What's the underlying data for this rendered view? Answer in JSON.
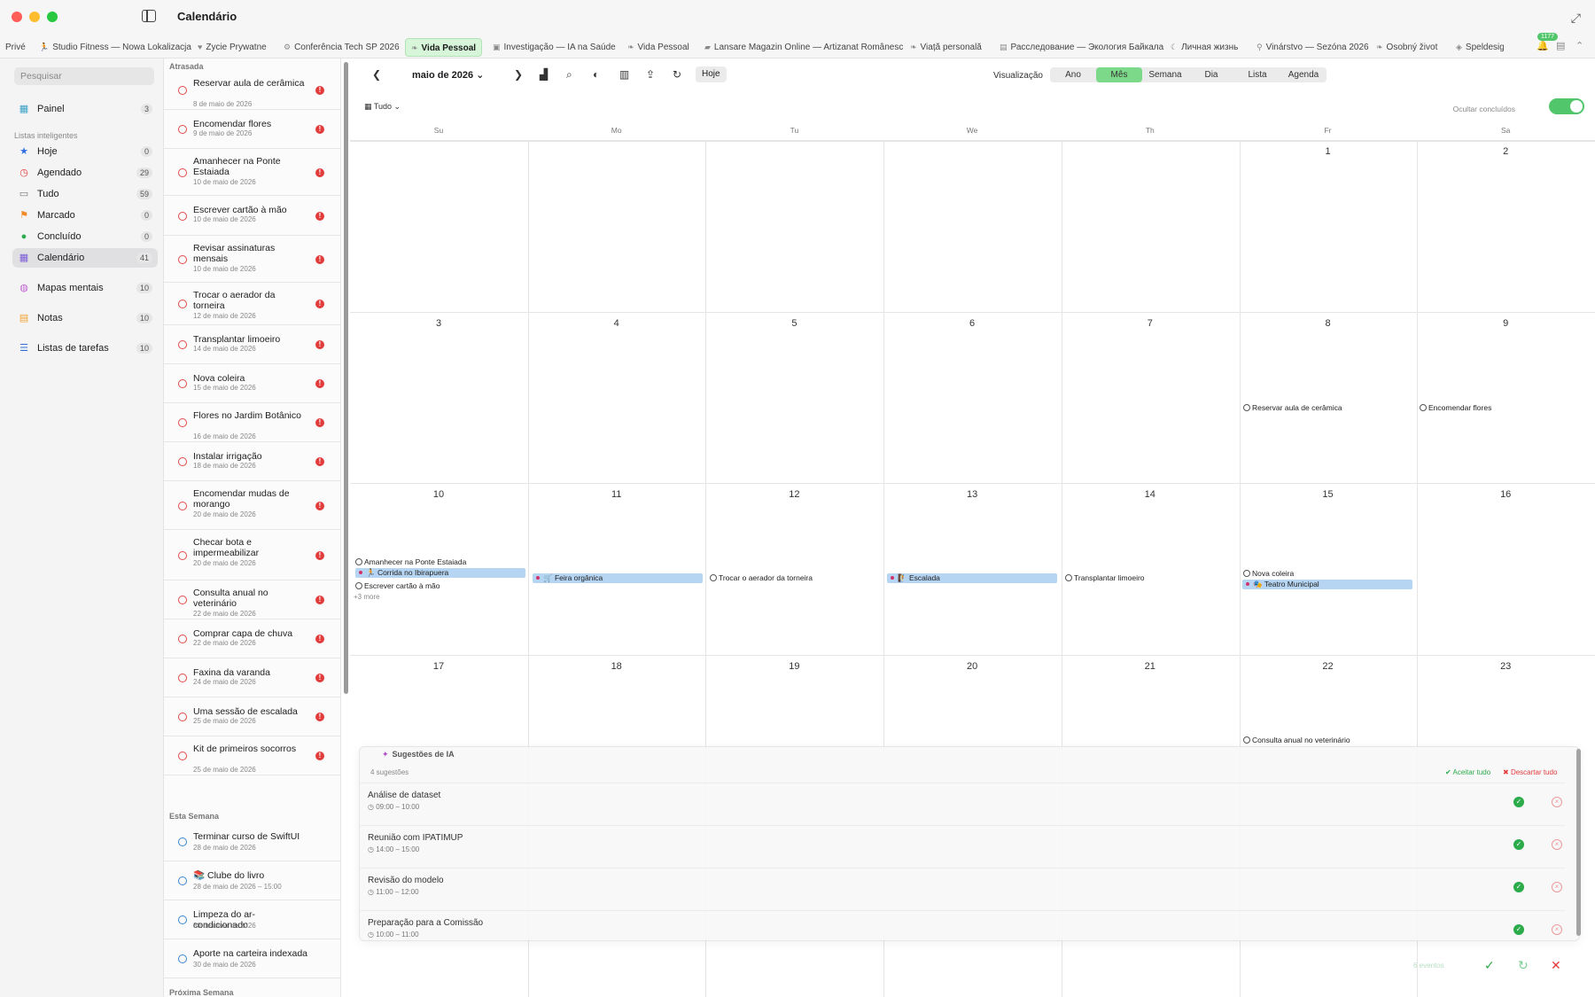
{
  "window": {
    "title": "Calendário"
  },
  "tabs": [
    {
      "label": "Privé",
      "icon": ""
    },
    {
      "label": "Studio Fitness — Nowa Lokalizacja",
      "icon": "run-icon"
    },
    {
      "label": "Zycie Prywatne",
      "icon": "heart-icon"
    },
    {
      "label": "Conferência Tech SP 2026",
      "icon": "gear-icon"
    },
    {
      "label": "Vida Pessoal",
      "icon": "leaf-icon",
      "active": true
    },
    {
      "label": "Investigação — IA na Saúde",
      "icon": "briefcase-icon"
    },
    {
      "label": "Vida Pessoal",
      "icon": "leaf-icon"
    },
    {
      "label": "Lansare Magazin Online — Artizanat Românesc",
      "icon": "bag-icon"
    },
    {
      "label": "Viață personală",
      "icon": "leaf-icon"
    },
    {
      "label": "Расследование — Экология Байкала",
      "icon": "doc-icon"
    },
    {
      "label": "Личная жизнь",
      "icon": "moon-icon"
    },
    {
      "label": "Vinárstvo — Sezóna 2026",
      "icon": "pin-icon"
    },
    {
      "label": "Osobný život",
      "icon": "leaf-icon"
    },
    {
      "label": "Speldesign — A",
      "icon": "game-icon"
    }
  ],
  "tab_badge": "1177",
  "sidebar": {
    "search_placeholder": "Pesquisar",
    "dashboard": {
      "label": "Painel",
      "count": "3"
    },
    "smart_lists_header": "Listas inteligentes",
    "items": [
      {
        "label": "Hoje",
        "count": "0",
        "icon": "star-icon",
        "color": "#2f6fe0"
      },
      {
        "label": "Agendado",
        "count": "29",
        "icon": "clock-icon",
        "color": "#e23b3b"
      },
      {
        "label": "Tudo",
        "count": "59",
        "icon": "tray-icon",
        "color": "#777777"
      },
      {
        "label": "Marcado",
        "count": "0",
        "icon": "flag-icon",
        "color": "#f08a24"
      },
      {
        "label": "Concluído",
        "count": "0",
        "icon": "check-circle-icon",
        "color": "#2bab4a"
      },
      {
        "label": "Calendário",
        "count": "41",
        "icon": "calendar-icon",
        "color": "#7b5cd6"
      }
    ],
    "extra": [
      {
        "label": "Mapas mentais",
        "count": "10",
        "icon": "brain-icon"
      },
      {
        "label": "Notas",
        "count": "10",
        "icon": "note-icon"
      },
      {
        "label": "Listas de tarefas",
        "count": "10",
        "icon": "list-icon"
      }
    ]
  },
  "tasks": {
    "overdue_header": "Atrasada",
    "overdue": [
      {
        "title": "Reservar aula de cerâmica",
        "date": "8 de maio de 2026"
      },
      {
        "title": "Encomendar flores",
        "date": "9 de maio de 2026"
      },
      {
        "title": "Amanhecer na Ponte Estaiada",
        "date": "10 de maio de 2026"
      },
      {
        "title": "Escrever cartão à mão",
        "date": "10 de maio de 2026"
      },
      {
        "title": "Revisar assinaturas mensais",
        "date": "10 de maio de 2026"
      },
      {
        "title": "Trocar o aerador da torneira",
        "date": "12 de maio de 2026"
      },
      {
        "title": "Transplantar limoeiro",
        "date": "14 de maio de 2026"
      },
      {
        "title": "Nova coleira",
        "date": "15 de maio de 2026"
      },
      {
        "title": "Flores no Jardim Botânico",
        "date": "16 de maio de 2026"
      },
      {
        "title": "Instalar irrigação",
        "date": "18 de maio de 2026"
      },
      {
        "title": "Encomendar mudas de morango",
        "date": "20 de maio de 2026"
      },
      {
        "title": "Checar bota e impermeabilizar",
        "date": "20 de maio de 2026"
      },
      {
        "title": "Consulta anual no veterinário",
        "date": "22 de maio de 2026"
      },
      {
        "title": "Comprar capa de chuva",
        "date": "22 de maio de 2026"
      },
      {
        "title": "Faxina da varanda",
        "date": "24 de maio de 2026"
      },
      {
        "title": "Uma sessão de escalada",
        "date": "25 de maio de 2026"
      },
      {
        "title": "Kit de primeiros socorros",
        "date": "25 de maio de 2026"
      }
    ],
    "week_header": "Esta Semana",
    "week": [
      {
        "title": "Terminar curso de SwiftUI",
        "date": "28 de maio de 2026"
      },
      {
        "title": "📚 Clube do livro",
        "date": "28 de maio de 2026 – 15:00"
      },
      {
        "title": "Limpeza do ar-condicionado",
        "date": "30 de maio de 2026"
      },
      {
        "title": "Aporte na carteira indexada",
        "date": "30 de maio de 2026"
      }
    ],
    "next_week_header": "Próxima Semana"
  },
  "toolbar": {
    "month_label": "maio de 2026",
    "today": "Hoje",
    "view_label": "Visualização",
    "views": [
      "Ano",
      "Mês",
      "Semana",
      "Dia",
      "Lista",
      "Agenda"
    ],
    "active_view": "Mês",
    "filter": "Tudo",
    "hide_completed": "Ocultar concluídos"
  },
  "weekdays": [
    "Su",
    "Mo",
    "Tu",
    "We",
    "Th",
    "Fr",
    "Sa"
  ],
  "weeks": [
    [
      "",
      "",
      "",
      "",
      "",
      "1",
      "2"
    ],
    [
      "3",
      "4",
      "5",
      "6",
      "7",
      "8",
      "9"
    ],
    [
      "10",
      "11",
      "12",
      "13",
      "14",
      "15",
      "16"
    ],
    [
      "17",
      "18",
      "19",
      "20",
      "21",
      "22",
      "23"
    ]
  ],
  "events": {
    "d8": "Reservar aula de cerâmica",
    "d9": "Encomendar flores",
    "d10a": "Amanhecer na Ponte Estaiada",
    "d10b": "🏃 Corrida no Ibirapuera",
    "d10c": "Escrever cartão à mão",
    "d10more": "+3 more",
    "d11": "🛒 Feira orgânica",
    "d12": "Trocar o aerador da torneira",
    "d13": "🧗 Escalada",
    "d14": "Transplantar limoeiro",
    "d15a": "Nova coleira",
    "d15b": "🎭 Teatro Municipal",
    "d22": "Consulta anual no veterinário"
  },
  "ai": {
    "title": "Sugestões de IA",
    "count": "4 sugestões",
    "accept_all": "Aceitar tudo",
    "discard_all": "Descartar tudo",
    "suggestions": [
      {
        "title": "Análise de dataset",
        "time": "09:00 – 10:00"
      },
      {
        "title": "Reunião com IPATIMUP",
        "time": "14:00 – 15:00"
      },
      {
        "title": "Revisão do modelo",
        "time": "11:00 – 12:00"
      },
      {
        "title": "Preparação para a Comissão",
        "time": "10:00 – 11:00"
      }
    ]
  },
  "bottom": {
    "events_label": "6 eventos"
  }
}
